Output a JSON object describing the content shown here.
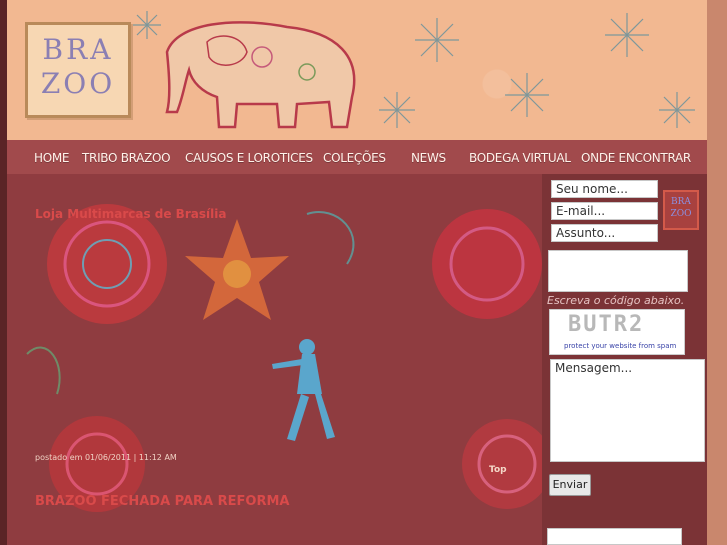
{
  "brand": {
    "logo_line1": "BRA",
    "logo_line2": "ZOO"
  },
  "nav": {
    "items": [
      "HOME",
      "TRIBO BRAZOO",
      "CAUSOS E LOROTICES",
      "COLEÇÕES",
      "NEWS",
      "BODEGA VIRTUAL",
      "ONDE ENCONTRAR"
    ]
  },
  "posts": [
    {
      "title": "Loja Multimarcas de Brasília",
      "meta": ""
    },
    {
      "title": "BRAZOO FECHADA PARA REFORMA",
      "meta": "postado em 01/06/2011 | 11:12 AM"
    }
  ],
  "top_link": "Top",
  "contact_form": {
    "name_placeholder": "Seu nome...",
    "email_placeholder": "E-mail...",
    "subject_placeholder": "Assunto...",
    "captcha_label": "Escreva o código abaixo.",
    "captcha_word": "BUTR2",
    "captcha_caption": "protect your website from spam",
    "message_placeholder": "Mensagem...",
    "send_label": "Enviar"
  },
  "colors": {
    "header_bg": "#f2b891",
    "nav_bg": "#a14a4c",
    "main_bg": "#8f3c40",
    "post_title": "#d94a4a"
  }
}
